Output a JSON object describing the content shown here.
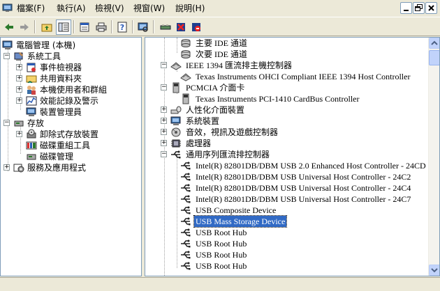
{
  "menu": [
    "檔案(F)",
    "執行(A)",
    "檢視(V)",
    "視窗(W)",
    "說明(H)"
  ],
  "left_tree": [
    {
      "label": "電腦管理 (本機)",
      "icon": "computer-management-icon"
    },
    {
      "label": "系統工具",
      "icon": "system-tools-icon"
    },
    {
      "label": "事件檢視器",
      "icon": "event-viewer-icon"
    },
    {
      "label": "共用資料夾",
      "icon": "shared-folder-icon"
    },
    {
      "label": "本機使用者和群組",
      "icon": "users-groups-icon"
    },
    {
      "label": "效能記錄及警示",
      "icon": "performance-icon"
    },
    {
      "label": "裝置管理員",
      "icon": "device-manager-icon"
    },
    {
      "label": "存放",
      "icon": "storage-icon"
    },
    {
      "label": "卸除式存放裝置",
      "icon": "removable-storage-icon"
    },
    {
      "label": "磁碟重組工具",
      "icon": "defrag-icon"
    },
    {
      "label": "磁碟管理",
      "icon": "disk-management-icon"
    },
    {
      "label": "服務及應用程式",
      "icon": "services-apps-icon"
    }
  ],
  "right_tree": [
    {
      "label": "主要 IDE 通道",
      "icon": "ide-channel-icon"
    },
    {
      "label": "次要 IDE 通道",
      "icon": "ide-channel-icon"
    },
    {
      "label": "IEEE 1394 匯流排主機控制器",
      "icon": "ieee1394-icon"
    },
    {
      "label": "Texas Instruments OHCI Compliant IEEE 1394 Host Controller",
      "icon": "ieee1394-device-icon"
    },
    {
      "label": "PCMCIA 介面卡",
      "icon": "pcmcia-icon"
    },
    {
      "label": "Texas Instruments PCI-1410 CardBus Controller",
      "icon": "pcmcia-device-icon"
    },
    {
      "label": "人性化介面裝置",
      "icon": "hid-icon"
    },
    {
      "label": "系統裝置",
      "icon": "system-devices-icon"
    },
    {
      "label": "音效，視訊及遊戲控制器",
      "icon": "sound-icon"
    },
    {
      "label": "處理器",
      "icon": "processor-icon"
    },
    {
      "label": "通用序列匯流排控制器",
      "icon": "usb-icon"
    },
    {
      "label": "Intel(R) 82801DB/DBM USB 2.0 Enhanced Host Controller - 24CD",
      "icon": "usb-icon"
    },
    {
      "label": "Intel(R) 82801DB/DBM USB Universal Host Controller - 24C2",
      "icon": "usb-icon"
    },
    {
      "label": "Intel(R) 82801DB/DBM USB Universal Host Controller - 24C4",
      "icon": "usb-icon"
    },
    {
      "label": "Intel(R) 82801DB/DBM USB Universal Host Controller - 24C7",
      "icon": "usb-icon"
    },
    {
      "label": "USB Composite Device",
      "icon": "usb-icon"
    },
    {
      "label": "USB Mass Storage Device",
      "icon": "usb-icon"
    },
    {
      "label": "USB Root Hub",
      "icon": "usb-icon"
    },
    {
      "label": "USB Root Hub",
      "icon": "usb-icon"
    },
    {
      "label": "USB Root Hub",
      "icon": "usb-icon"
    },
    {
      "label": "USB Root Hub",
      "icon": "usb-icon"
    }
  ],
  "selected_right": "USB Mass Storage Device",
  "colors": {
    "selection": "#316AC5",
    "chrome": "#ECE9D8",
    "border": "#7F9DB9"
  }
}
